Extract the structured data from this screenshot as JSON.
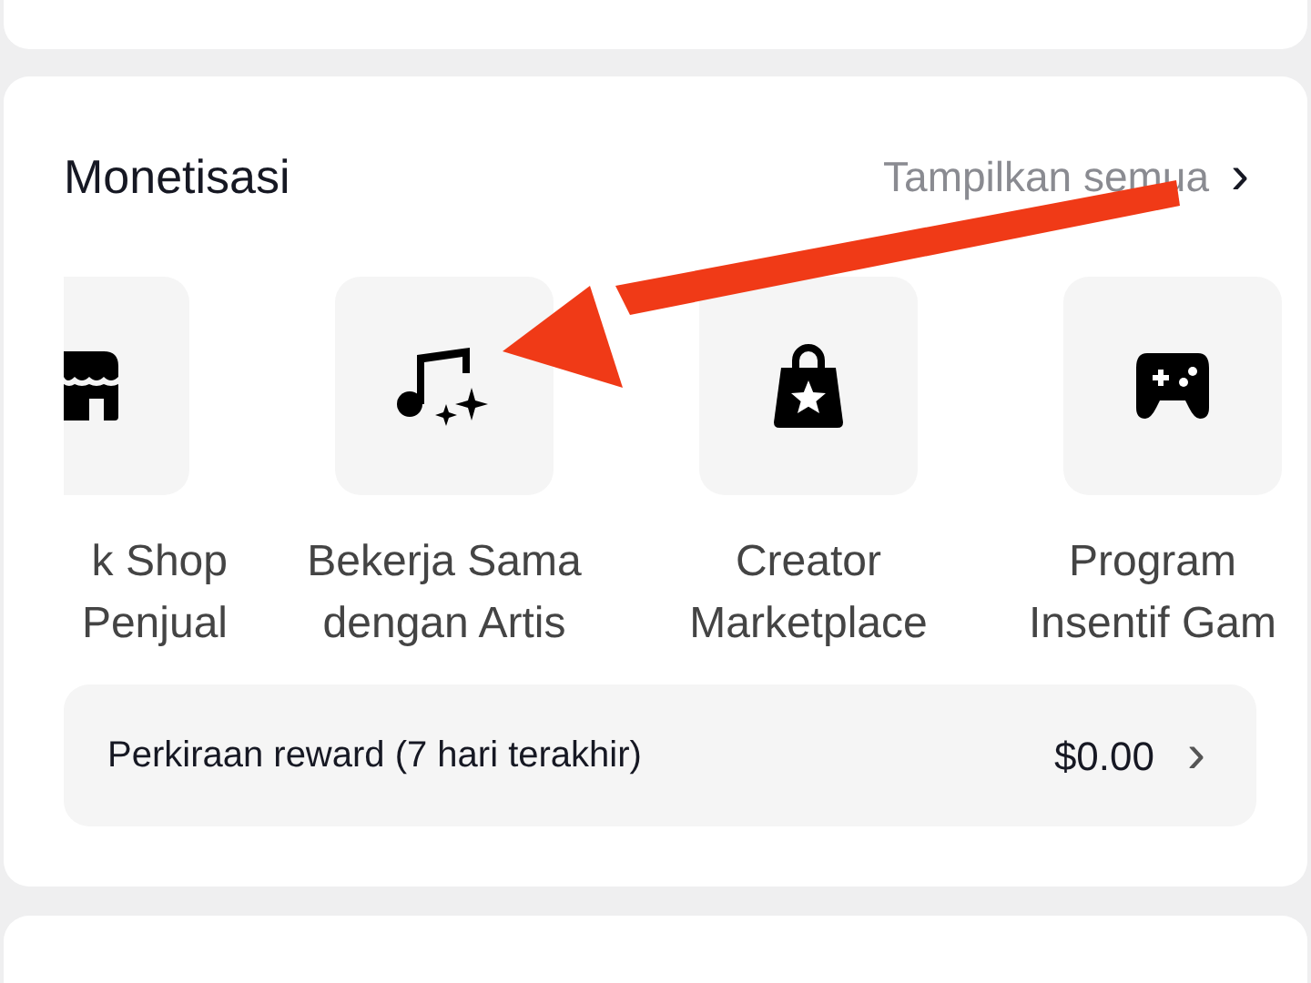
{
  "section": {
    "title": "Monetisasi",
    "see_all": "Tampilkan semua",
    "see_all_chevron": "›"
  },
  "items": [
    {
      "kind": "cut-left",
      "label": [
        "k Shop",
        "Penjual"
      ]
    },
    {
      "kind": "full",
      "label": [
        "Bekerja Sama",
        "dengan Artis"
      ]
    },
    {
      "kind": "full",
      "label": [
        "Creator",
        "Marketplace"
      ]
    },
    {
      "kind": "cut-right",
      "label": [
        "Program",
        "Insentif Gam"
      ]
    }
  ],
  "reward": {
    "label": "Perkiraan reward (7 hari terakhir)",
    "value": "$0.00",
    "chevron": "›"
  },
  "annotation": {
    "kind": "arrow"
  }
}
